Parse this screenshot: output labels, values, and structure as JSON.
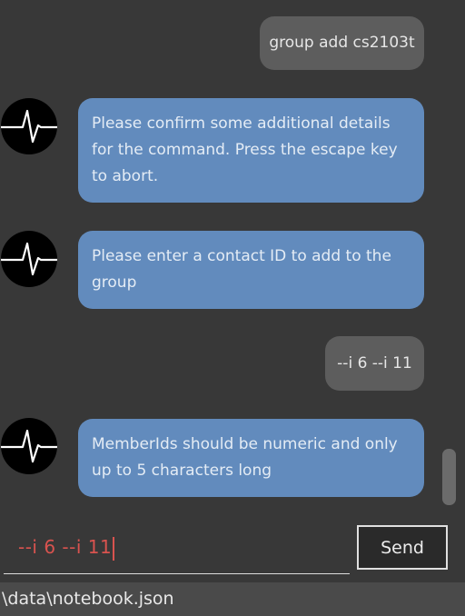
{
  "messages": [
    {
      "sender": "user",
      "text": "group add cs2103t"
    },
    {
      "sender": "bot",
      "text": "Please confirm some additional details for the command. Press the escape key to abort."
    },
    {
      "sender": "bot",
      "text": "Please enter a contact ID to add to the group"
    },
    {
      "sender": "user",
      "text": "--i 6 --i 11"
    },
    {
      "sender": "bot",
      "text": "MemberIds should be numeric and only up to 5 characters long"
    }
  ],
  "bot_avatar_icon": "heartbeat-icon",
  "input": {
    "value": "--i 6 --i 11"
  },
  "send_label": "Send",
  "status_bar": {
    "path": "\\data\\notebook.json"
  },
  "colors": {
    "background": "#383838",
    "user_bubble": "#5d5d5d",
    "bot_bubble": "#628bbd",
    "input_text": "#d9534f"
  }
}
